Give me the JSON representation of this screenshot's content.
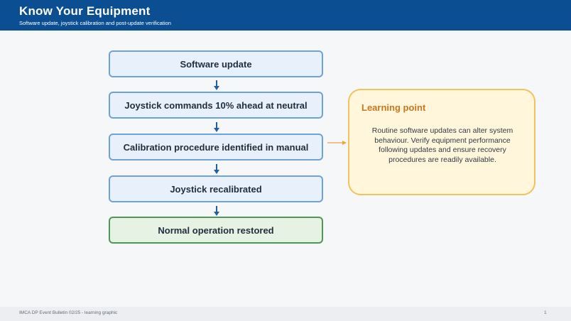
{
  "header": {
    "title": "Know Your Equipment",
    "subtitle": "Software update, joystick calibration and post-update verification"
  },
  "flow": {
    "steps": [
      "Software update",
      "Joystick commands 10% ahead at neutral",
      "Calibration procedure identified in manual",
      "Joystick recalibrated",
      "Normal operation restored"
    ]
  },
  "learning_point": {
    "title": "Learning point",
    "text": "Routine software updates can alter system behaviour. Verify equipment performance following updates and ensure recovery procedures are readily available."
  },
  "footer": {
    "source": "IMCA DP Event Bulletin 02/25 - learning graphic",
    "page_number": "1"
  },
  "colors": {
    "header_bg": "#0b4f92",
    "step_border": "#6ea3d8",
    "step_fill": "#e8f1fb",
    "final_border": "#4c9a52",
    "final_fill": "#e6f2e4",
    "arrow": "#1f5fa3",
    "learning_border": "#f0c35c",
    "learning_fill": "#fff6dc",
    "learning_title": "#c8771b",
    "connector": "#e8a640"
  }
}
